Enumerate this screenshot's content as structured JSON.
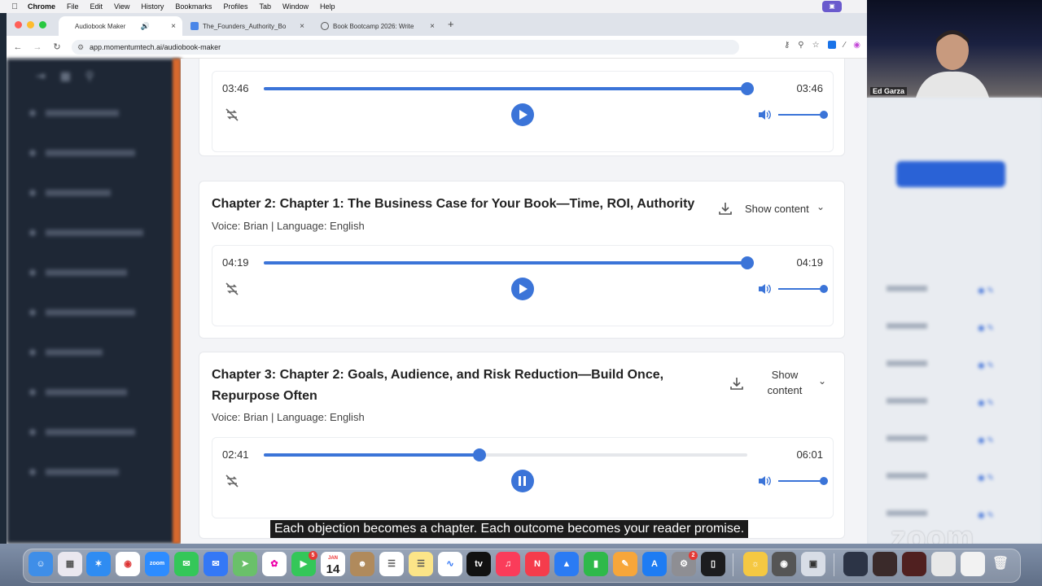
{
  "menubar": {
    "app_name": "Chrome",
    "items": [
      "File",
      "Edit",
      "View",
      "History",
      "Bookmarks",
      "Profiles",
      "Tab",
      "Window",
      "Help"
    ]
  },
  "browser": {
    "tabs": [
      {
        "label": "Audiobook Maker",
        "active": true
      },
      {
        "label": "The_Founders_Authority_Bo",
        "active": false
      },
      {
        "label": "Book Bootcamp 2026: Write",
        "active": false
      }
    ],
    "url": "app.momentumtech.ai/audiobook-maker"
  },
  "app": {
    "chapters": [
      {
        "time_current": "03:46",
        "time_total": "03:46",
        "progress": 1.0,
        "volume": 1.0
      },
      {
        "title": "Chapter 2: Chapter 1: The Business Case for Your Book—Time, ROI, Authority",
        "meta": "Voice: Brian | Language: English",
        "show_content_label": "Show content",
        "time_current": "04:19",
        "time_total": "04:19",
        "progress": 1.0,
        "volume": 1.0
      },
      {
        "title_line1": "Chapter 3: Chapter 2: Goals, Audience, and Risk Reduction—Build Once,",
        "title_line2": "Repurpose Often",
        "meta": "Voice: Brian | Language: English",
        "show_content_line1": "Show",
        "show_content_line2": "content",
        "time_current": "02:41",
        "time_total": "06:01",
        "progress": 0.446,
        "volume": 1.0
      }
    ]
  },
  "zoom": {
    "participant_name": "Ed Garza",
    "logo": "zoom"
  },
  "subtitle": "Each objection becomes a chapter. Each outcome becomes your reader promise.",
  "dock": {
    "calendar_month": "JAN",
    "calendar_day": "14",
    "facetime_badge": "5",
    "settings_badge": "2"
  },
  "colors": {
    "accent": "#3b74d8",
    "sidebar": "#1e2735"
  }
}
